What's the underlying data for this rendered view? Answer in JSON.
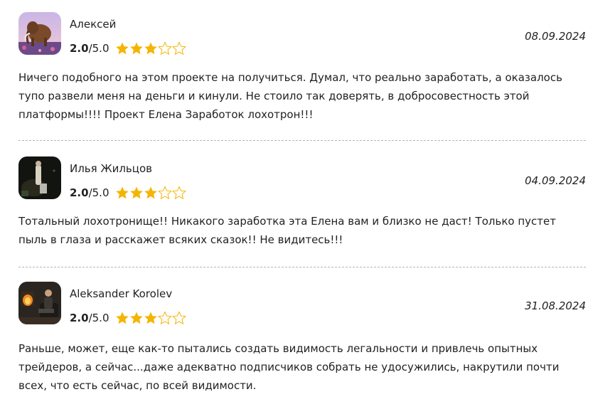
{
  "reviews": [
    {
      "author": "Алексей",
      "score": "2.0",
      "max": "/5.0",
      "stars_filled": 3,
      "stars_total": 5,
      "date": "08.09.2024",
      "avatar": "mammoth-avatar",
      "text": "Ничего подобного на этом проекте на получиться. Думал, что реально заработать, а оказалось тупо развели меня на деньги и кинули. Не стоило так доверять, в добросовестность этой платформы!!!! Проект Елена Заработок лохотрон!!!"
    },
    {
      "author": "Илья Жильцов",
      "score": "2.0",
      "max": "/5.0",
      "stars_filled": 3,
      "stars_total": 5,
      "date": "04.09.2024",
      "avatar": "night-photo-avatar",
      "text": "Тотальный лохотронище!! Никакого заработка эта Елена вам и близко не даст! Только пустет пыль в глаза и расскажет всяких сказок!! Не видитесь!!!"
    },
    {
      "author": "Aleksander Korolev",
      "score": "2.0",
      "max": "/5.0",
      "stars_filled": 3,
      "stars_total": 5,
      "date": "31.08.2024",
      "avatar": "fireplace-avatar",
      "text": "Раньше, может, еще как-то пытались создать видимость легальности и привлечь опытных трейдеров, а сейчас...даже адекватно подписчиков собрать не удосужились, накрутили почти всех, что есть сейчас, по всей видимости."
    }
  ],
  "colors": {
    "star_filled": "#f5b400",
    "star_empty": "#f5b400",
    "divider": "#b5b5b5",
    "text": "#222222"
  }
}
